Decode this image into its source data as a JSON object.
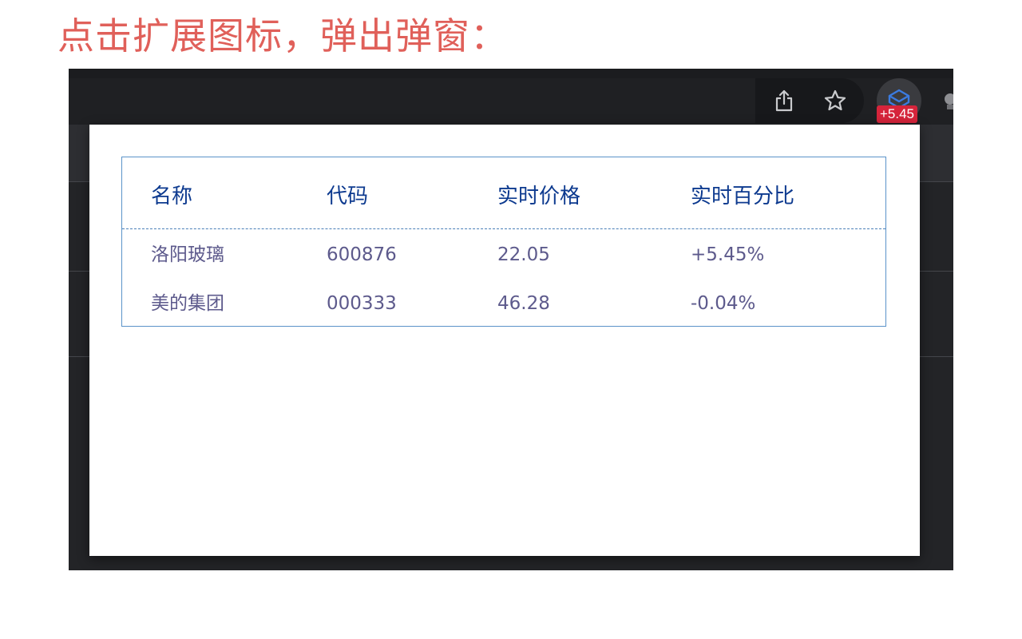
{
  "caption": "点击扩展图标，弹出弹窗：",
  "toolbar": {
    "share_icon": "share-icon",
    "bookmark_icon": "star-icon",
    "extension_icon": "extension-icon",
    "extension_badge": "+5.45",
    "next_extension_icon": "extension-icon-partial"
  },
  "table": {
    "headers": [
      "名称",
      "代码",
      "实时价格",
      "实时百分比"
    ],
    "rows": [
      [
        "洛阳玻璃",
        "600876",
        "22.05",
        "+5.45%"
      ],
      [
        "美的集团",
        "000333",
        "46.28",
        "-0.04%"
      ]
    ]
  },
  "colors": {
    "caption": "#e0605a",
    "header_text": "#0d3a8f",
    "cell_text": "#5d5a8c",
    "table_border": "#5b93c9",
    "badge_bg": "#d6243b"
  }
}
